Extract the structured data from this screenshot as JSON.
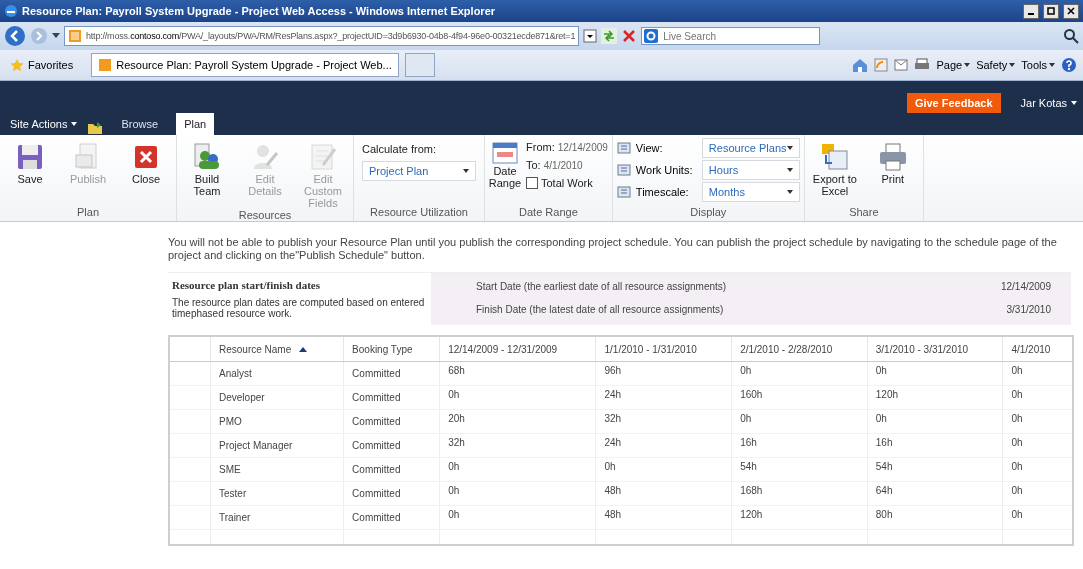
{
  "window": {
    "title": "Resource Plan: Payroll System Upgrade - Project Web Access - Windows Internet Explorer"
  },
  "browser": {
    "address": "http://moss.**contoso.com**/PWA/_layouts/PWA/RM/ResPlans.aspx?_projectUID=3d9b6930-04b8-4f94-96e0-00321ecde871&ret=1",
    "search_placeholder": "Live Search",
    "favorites": "Favorites",
    "tab": "Resource Plan: Payroll System Upgrade - Project Web...",
    "commands": [
      "Page",
      "Safety",
      "Tools"
    ]
  },
  "site_bar": {
    "site_actions": "Site Actions",
    "tabs": [
      {
        "label": "Browse",
        "selected": false
      },
      {
        "label": "Plan",
        "selected": true
      }
    ],
    "feedback": "Give Feedback",
    "user": "Jar Kotas"
  },
  "ribbon": [
    {
      "kind": "buttons",
      "label": "Plan",
      "items": [
        {
          "label": "Save",
          "disabled": false
        },
        {
          "label": "Publish",
          "disabled": true
        },
        {
          "label": "Close",
          "disabled": false
        }
      ]
    },
    {
      "kind": "buttons",
      "label": "Resources",
      "items": [
        {
          "label": "Build Team",
          "disabled": false
        },
        {
          "label": "Edit Details",
          "disabled": true
        },
        {
          "label": "Edit Custom Fields",
          "disabled": true
        }
      ]
    },
    {
      "kind": "select",
      "label": "Resource Utilization",
      "title": "Calculate from:",
      "value": "Project Plan"
    },
    {
      "kind": "daterange",
      "label": "Date Range",
      "button": "Date Range",
      "from_label": "From:",
      "from": "12/14/2009",
      "to_label": "To:",
      "to": "4/1/2010",
      "total_work": {
        "label": "Total Work",
        "checked": false
      }
    },
    {
      "kind": "fields",
      "label": "Display",
      "rows": [
        {
          "label": "View:",
          "value": "Resource Plans"
        },
        {
          "label": "Work Units:",
          "value": "Hours"
        },
        {
          "label": "Timescale:",
          "value": "Months"
        }
      ]
    },
    {
      "kind": "buttons",
      "label": "Share",
      "items": [
        {
          "label": "Export to Excel",
          "disabled": false
        },
        {
          "label": "Print",
          "disabled": false
        }
      ]
    }
  ],
  "message": "You will not be able to publish your Resource Plan until you publish the corresponding project schedule. You can publish the project schedule by navigating to the schedule page of the project and clicking on the\"Publish Schedule\" button.",
  "dates_panel": {
    "title": "Resource plan start/finish dates",
    "description": "The resource plan dates are computed based on entered timephased resource work.",
    "rows": [
      {
        "label": "Start Date (the earliest date of all resource assignments)",
        "value": "12/14/2009"
      },
      {
        "label": "Finish Date (the latest date of all resource assignments)",
        "value": "3/31/2010"
      }
    ]
  },
  "table": {
    "columns": [
      {
        "label": "Resource Name",
        "sorted": true
      },
      {
        "label": "Booking Type",
        "sorted": false
      },
      {
        "label": "12/14/2009 - 12/31/2009",
        "sorted": false
      },
      {
        "label": "1/1/2010 - 1/31/2010",
        "sorted": false
      },
      {
        "label": "2/1/2010 - 2/28/2010",
        "sorted": false
      },
      {
        "label": "3/1/2010 - 3/31/2010",
        "sorted": false
      },
      {
        "label": "4/1/2010",
        "sorted": false
      }
    ],
    "rows": [
      [
        "Analyst",
        "Committed",
        "68h",
        "96h",
        "0h",
        "0h",
        "0h"
      ],
      [
        "Developer",
        "Committed",
        "0h",
        "24h",
        "160h",
        "120h",
        "0h"
      ],
      [
        "PMO",
        "Committed",
        "20h",
        "32h",
        "0h",
        "0h",
        "0h"
      ],
      [
        "Project Manager",
        "Committed",
        "32h",
        "24h",
        "16h",
        "16h",
        "0h"
      ],
      [
        "SME",
        "Committed",
        "0h",
        "0h",
        "54h",
        "54h",
        "0h"
      ],
      [
        "Tester",
        "Committed",
        "0h",
        "48h",
        "168h",
        "64h",
        "0h"
      ],
      [
        "Trainer",
        "Committed",
        "0h",
        "48h",
        "120h",
        "80h",
        "0h"
      ]
    ]
  }
}
